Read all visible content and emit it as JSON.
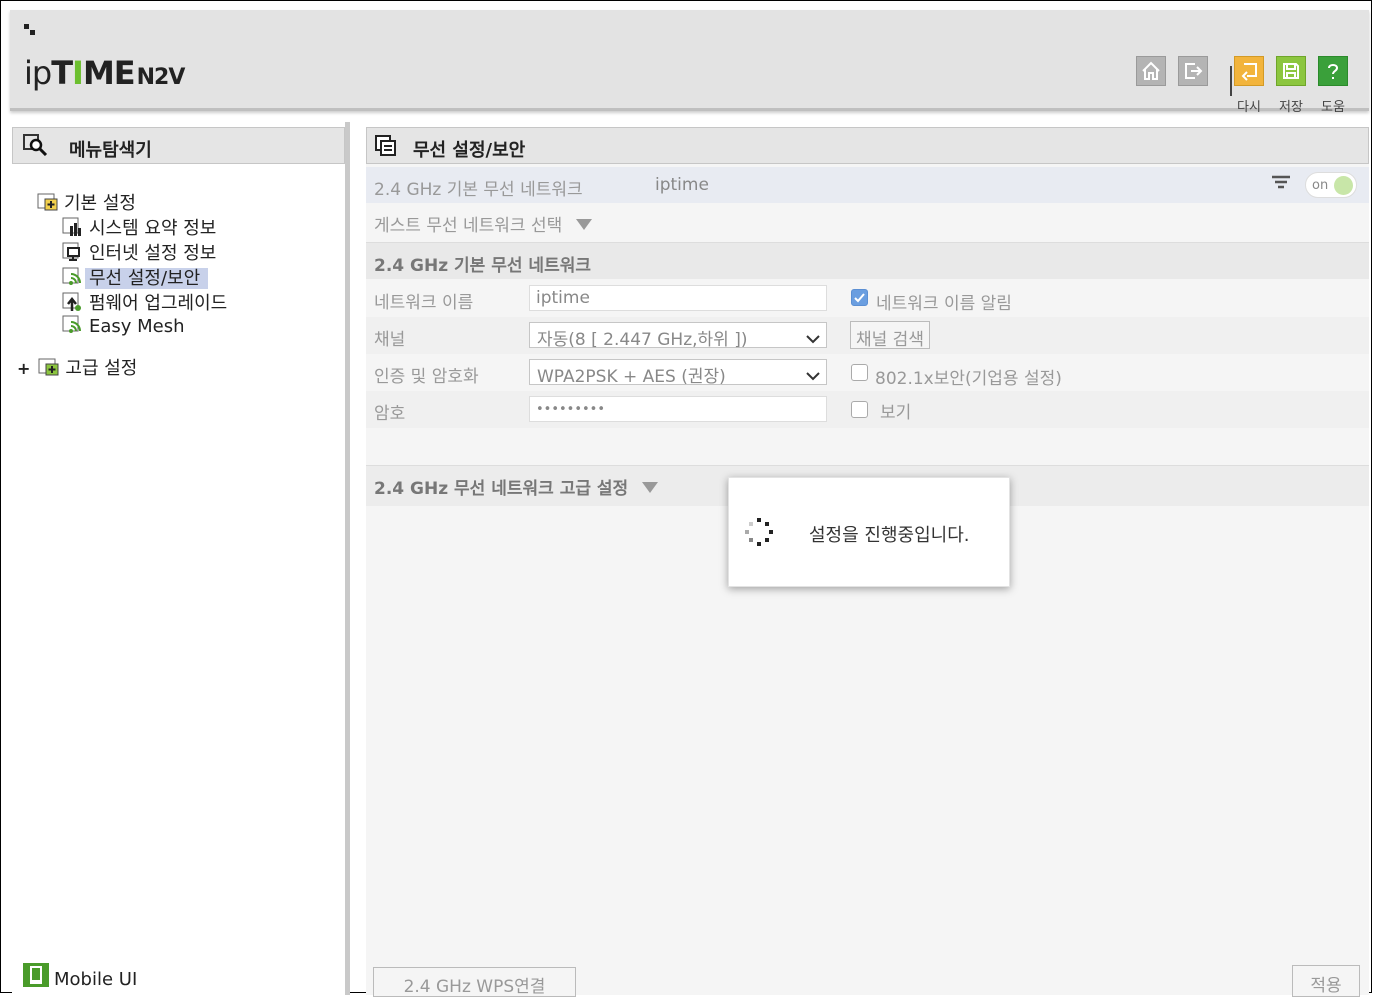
{
  "header": {
    "logo_ip": "ip",
    "logo_ti": "T",
    "logo_i": "I",
    "logo_me": "ME",
    "logo_model": "N2V",
    "buttons": {
      "retry_label": "다시",
      "save_label": "저장",
      "help_label": "도움"
    }
  },
  "sidebar": {
    "title": "메뉴탐색기",
    "groups": [
      {
        "label": "기본 설정",
        "items": [
          {
            "label": "시스템 요약 정보"
          },
          {
            "label": "인터넷 설정 정보"
          },
          {
            "label": "무선 설정/보안"
          },
          {
            "label": "펌웨어 업그레이드"
          },
          {
            "label": "Easy Mesh"
          }
        ]
      },
      {
        "expander": "+",
        "label": "고급 설정"
      }
    ],
    "mobile_ui": "Mobile UI"
  },
  "main": {
    "title": "무선 설정/보안",
    "network_bar": {
      "band_label": "2.4 GHz 기본 무선 네트워크",
      "ssid": "iptime",
      "toggle_text": "on"
    },
    "guest_select": "게스트 무선 네트워크 선택",
    "basic_section": {
      "title": "2.4 GHz 기본 무선 네트워크",
      "network_name_label": "네트워크 이름",
      "network_name_value": "iptime",
      "broadcast_label": "네트워크 이름 알림",
      "channel_label": "채널",
      "channel_value": "자동(8 [ 2.447 GHz,하위 ])",
      "channel_scan_button": "채널 검색",
      "auth_label": "인증 및 암호화",
      "auth_value": "WPA2PSK + AES (권장)",
      "enterprise_label": "802.1x보안(기업용 설정)",
      "password_label": "암호",
      "password_value": "•••••••••",
      "show_label": "보기"
    },
    "advanced_section": {
      "title": "2.4 GHz 무선 네트워크 고급 설정"
    },
    "wps_button": "2.4 GHz WPS연결",
    "apply_button": "적용"
  },
  "modal": {
    "message": "설정을 진행중입니다."
  },
  "colors": {
    "accent_green": "#6cbf2f",
    "selected_bg": "#c8d1ea",
    "checkbox_blue": "#6a9ee0"
  }
}
